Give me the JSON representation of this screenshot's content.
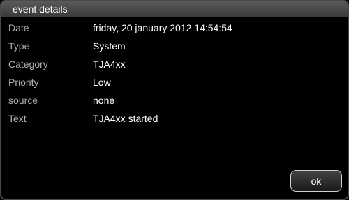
{
  "dialog": {
    "title": "event details"
  },
  "details": [
    {
      "label": "Date",
      "value": "friday, 20 january 2012 14:54:54"
    },
    {
      "label": "Type",
      "value": "System"
    },
    {
      "label": "Category",
      "value": "TJA4xx"
    },
    {
      "label": "Priority",
      "value": "Low"
    },
    {
      "label": "source",
      "value": "none"
    },
    {
      "label": "Text",
      "value": "TJA4xx started"
    }
  ],
  "buttons": {
    "ok_label": "ok"
  }
}
